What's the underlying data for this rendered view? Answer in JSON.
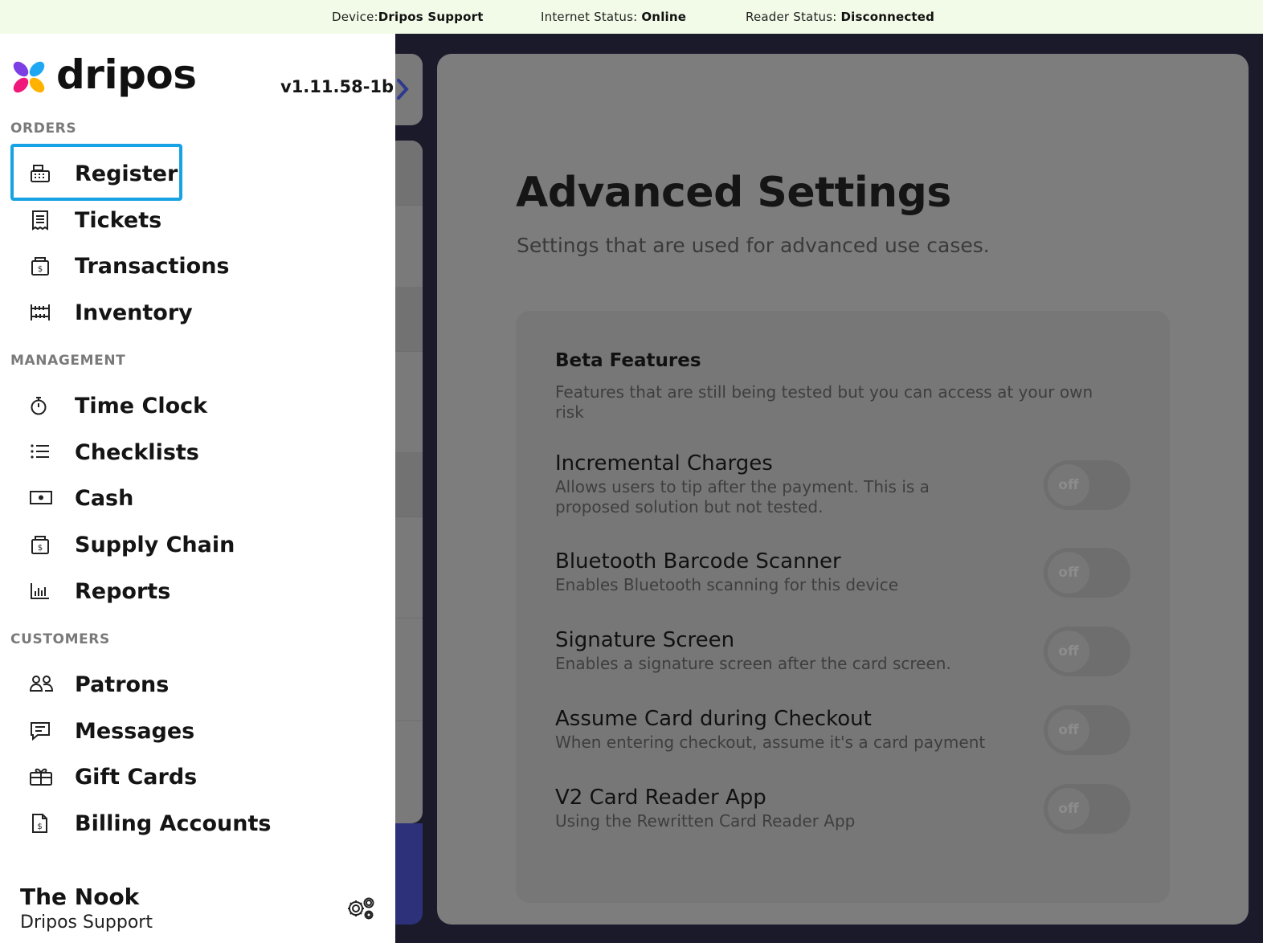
{
  "status_bar": {
    "device_label": "Device:",
    "device_value": "Dripos Support",
    "internet_label": "Internet Status: ",
    "internet_value": "Online",
    "reader_label": "Reader Status: ",
    "reader_value": "Disconnected"
  },
  "sidebar": {
    "logo_text": "dripos",
    "version": "v1.11.58-1b",
    "sections": {
      "orders": "ORDERS",
      "management": "MANAGEMENT",
      "customers": "CUSTOMERS"
    },
    "items": {
      "register": "Register",
      "tickets": "Tickets",
      "transactions": "Transactions",
      "inventory": "Inventory",
      "time_clock": "Time Clock",
      "checklists": "Checklists",
      "cash": "Cash",
      "supply_chain": "Supply Chain",
      "reports": "Reports",
      "patrons": "Patrons",
      "messages": "Messages",
      "gift_cards": "Gift Cards",
      "billing_accounts": "Billing Accounts"
    },
    "active_item": "Register",
    "footer": {
      "location": "The Nook",
      "account": "Dripos Support"
    },
    "colors": {
      "active_outline": "#17a2e3"
    }
  },
  "settings": {
    "title": "Advanced Settings",
    "subtitle": "Settings that are used for advanced use cases.",
    "section": {
      "title": "Beta Features",
      "description": "Features that are still being tested but you can access at your own risk"
    },
    "toggles": [
      {
        "name": "Incremental Charges",
        "description": "Allows users to tip after the payment. This is a proposed solution but not tested.",
        "state": "off"
      },
      {
        "name": "Bluetooth Barcode Scanner",
        "description": "Enables Bluetooth scanning for this device",
        "state": "off"
      },
      {
        "name": "Signature Screen",
        "description": "Enables a signature screen after the card screen.",
        "state": "off"
      },
      {
        "name": "Assume Card during Checkout",
        "description": "When entering checkout, assume it's a card payment",
        "state": "off"
      },
      {
        "name": "V2 Card Reader App",
        "description": "Using the Rewritten Card Reader App",
        "state": "off"
      }
    ]
  }
}
